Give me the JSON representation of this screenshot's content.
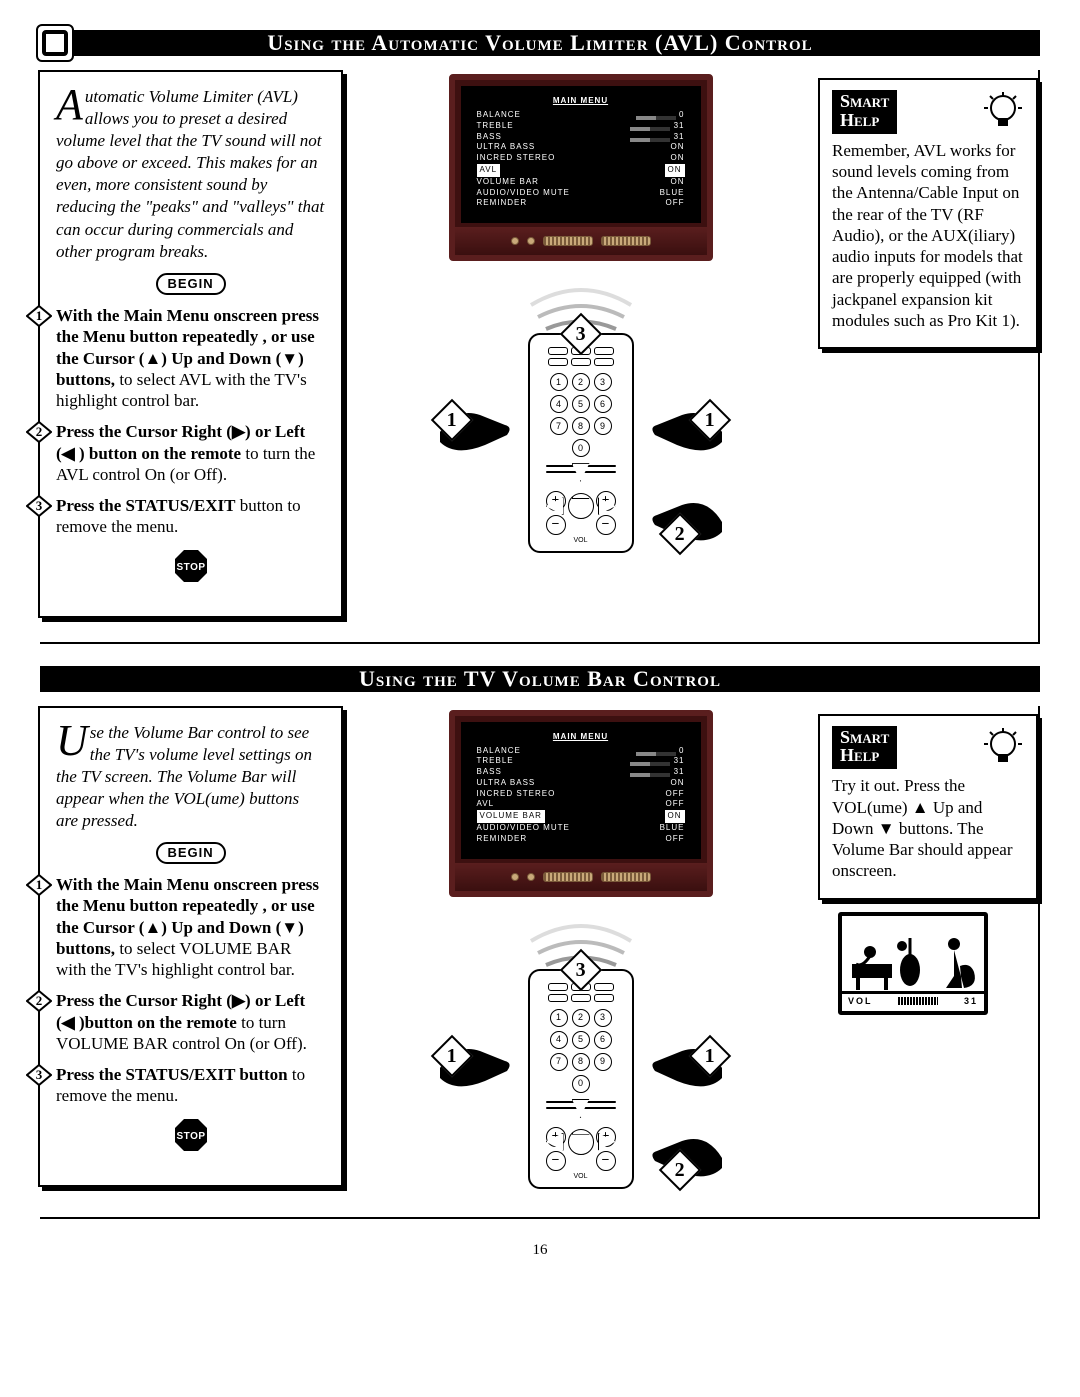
{
  "page_number": "16",
  "sections": [
    {
      "title": "Using the Automatic Volume Limiter (AVL) Control",
      "intro_dropcap": "A",
      "intro": "utomatic Volume Limiter (AVL) allows you to preset a desired volume level that the TV sound will not go above or exceed. This makes for an even, more consistent sound by reducing the \"peaks\" and \"valleys\" that can occur during commercials and other program breaks.",
      "begin": "BEGIN",
      "stop": "STOP",
      "steps": [
        {
          "n": "1",
          "bold": "With the Main Menu onscreen press the Menu button repeatedly , or use the Cursor (▲) Up and Down (▼) buttons,",
          "rest": " to select AVL with the TV's highlight control bar."
        },
        {
          "n": "2",
          "bold": "Press the Cursor Right (▶) or Left (◀ ) button on the remote",
          "rest": " to turn the AVL control On (or Off)."
        },
        {
          "n": "3",
          "bold": "Press the STATUS/EXIT",
          "rest": " button to remove the menu."
        }
      ],
      "callouts": [
        "3",
        "1",
        "1",
        "2"
      ],
      "tv_menu": {
        "title": "MAIN MENU",
        "rows": [
          {
            "label": "BALANCE",
            "value": "0",
            "slider": true
          },
          {
            "label": "TREBLE",
            "value": "31",
            "slider": true
          },
          {
            "label": "BASS",
            "value": "31",
            "slider": true
          },
          {
            "label": "ULTRA BASS",
            "value": "ON"
          },
          {
            "label": "INCRED STEREO",
            "value": "ON"
          },
          {
            "label": "AVL",
            "value": "ON",
            "hilite": true
          },
          {
            "label": "VOLUME BAR",
            "value": "ON"
          },
          {
            "label": "AUDIO/VIDEO MUTE",
            "value": "BLUE"
          },
          {
            "label": "REMINDER",
            "value": "OFF"
          }
        ]
      },
      "smart": {
        "title1": "Smart",
        "title2": "Help",
        "body": "Remember, AVL works for sound levels coming from the Antenna/Cable Input on the rear of the TV (RF Audio), or the AUX(iliary) audio inputs for models that are properly equipped (with jackpanel expansion kit modules such as Pro Kit 1)."
      }
    },
    {
      "title": "Using the TV Volume Bar Control",
      "intro_dropcap": "U",
      "intro": "se the Volume Bar control to see the TV's volume level settings on the TV screen. The Volume Bar will appear when the VOL(ume) buttons are pressed.",
      "begin": "BEGIN",
      "stop": "STOP",
      "steps": [
        {
          "n": "1",
          "bold": "With the Main Menu onscreen press the Menu button repeatedly , or use the Cursor (▲) Up and Down (▼) buttons,",
          "rest": " to select VOLUME BAR with the TV's highlight control bar."
        },
        {
          "n": "2",
          "bold": "Press the Cursor Right (▶) or Left (◀ )button on the remote",
          "rest": " to turn VOLUME BAR control On (or Off)."
        },
        {
          "n": "3",
          "bold": "Press the STATUS/EXIT button",
          "rest": " to remove the menu."
        }
      ],
      "callouts": [
        "3",
        "1",
        "1",
        "2"
      ],
      "tv_menu": {
        "title": "MAIN MENU",
        "rows": [
          {
            "label": "BALANCE",
            "value": "0",
            "slider": true
          },
          {
            "label": "TREBLE",
            "value": "31",
            "slider": true
          },
          {
            "label": "BASS",
            "value": "31",
            "slider": true
          },
          {
            "label": "ULTRA BASS",
            "value": "ON"
          },
          {
            "label": "INCRED STEREO",
            "value": "OFF"
          },
          {
            "label": "AVL",
            "value": "OFF"
          },
          {
            "label": "VOLUME BAR",
            "value": "ON",
            "hilite": true
          },
          {
            "label": "AUDIO/VIDEO MUTE",
            "value": "BLUE"
          },
          {
            "label": "REMINDER",
            "value": "OFF"
          }
        ]
      },
      "smart": {
        "title1": "Smart",
        "title2": "Help",
        "body": "Try it out. Press the VOL(ume) ▲ Up and Down ▼ buttons. The Volume Bar  should appear onscreen."
      },
      "mini_tv": {
        "label": "VOL",
        "value": "31"
      }
    }
  ]
}
